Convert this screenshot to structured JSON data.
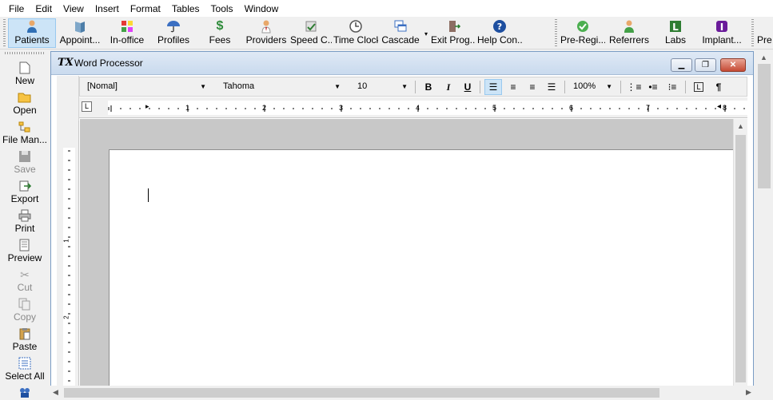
{
  "menu": [
    "File",
    "Edit",
    "View",
    "Insert",
    "Format",
    "Tables",
    "Tools",
    "Window"
  ],
  "toolbar": {
    "group1": [
      {
        "label": "Patients",
        "icon": "patient-icon",
        "active": true
      },
      {
        "label": "Appoint...",
        "icon": "book-icon"
      },
      {
        "label": "In-office",
        "icon": "color-squares-icon"
      },
      {
        "label": "Profiles",
        "icon": "umbrella-icon"
      },
      {
        "label": "Fees",
        "icon": "dollar-icon"
      },
      {
        "label": "Providers",
        "icon": "doctor-icon"
      },
      {
        "label": "Speed C...",
        "icon": "speed-codes-icon"
      },
      {
        "label": "Time Clock",
        "icon": "clock-icon"
      },
      {
        "label": "Cascade",
        "icon": "cascade-windows-icon"
      },
      {
        "label": "Exit Prog...",
        "icon": "exit-door-icon"
      },
      {
        "label": "Help Con...",
        "icon": "help-icon"
      }
    ],
    "group2": [
      {
        "label": "Pre-Regi...",
        "icon": "checkmark-icon"
      },
      {
        "label": "Referrers",
        "icon": "referrer-person-icon"
      },
      {
        "label": "Labs",
        "icon": "labs-icon"
      },
      {
        "label": "Implant...",
        "icon": "implant-icon"
      }
    ],
    "group3_partial": "Pre"
  },
  "sidebar": [
    {
      "label": "New",
      "icon": "new-document-icon",
      "enabled": true
    },
    {
      "label": "Open",
      "icon": "folder-open-icon",
      "enabled": true
    },
    {
      "label": "File Man...",
      "icon": "file-manager-icon",
      "enabled": true
    },
    {
      "label": "Save",
      "icon": "floppy-disk-icon",
      "enabled": false
    },
    {
      "label": "Export",
      "icon": "export-icon",
      "enabled": true
    },
    {
      "label": "Print",
      "icon": "printer-icon",
      "enabled": true
    },
    {
      "label": "Preview",
      "icon": "print-preview-icon",
      "enabled": true
    },
    {
      "label": "Cut",
      "icon": "scissors-icon",
      "enabled": false
    },
    {
      "label": "Copy",
      "icon": "copy-icon",
      "enabled": false
    },
    {
      "label": "Paste",
      "icon": "clipboard-icon",
      "enabled": true
    },
    {
      "label": "Select All",
      "icon": "select-all-icon",
      "enabled": true
    }
  ],
  "window": {
    "title": "Word Processor",
    "icon_text": "TX"
  },
  "format": {
    "style": "[Nomal]",
    "font": "Tahoma",
    "size": "10",
    "zoom": "100%",
    "bold": "B",
    "italic": "I",
    "underline": "U",
    "pilcrow": "¶"
  },
  "ruler": {
    "h_numbers": [
      "1",
      "2",
      "3",
      "4",
      "5",
      "6",
      "7",
      "8"
    ],
    "v_numbers": [
      "1",
      "2"
    ]
  },
  "colors": {
    "accent_active": "#cce4f7",
    "titlebar": "#c9daee",
    "close_button": "#c54a34"
  }
}
